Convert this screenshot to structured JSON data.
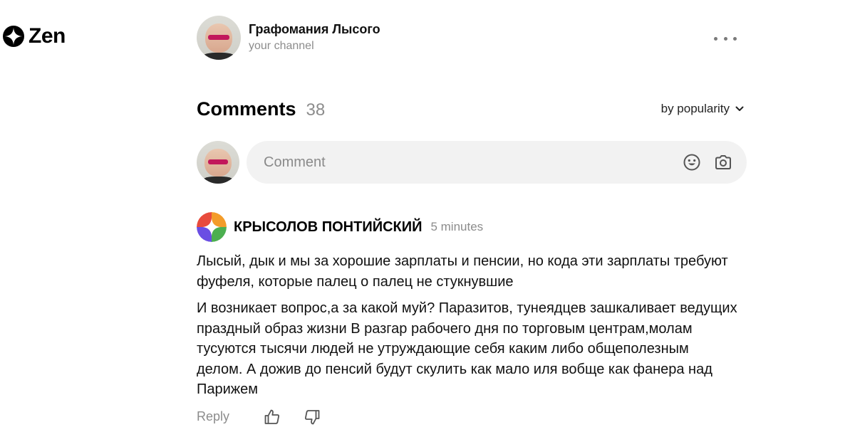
{
  "app": {
    "logo_text": "Zen"
  },
  "channel": {
    "name": "Графомания Лысого",
    "subtitle": "your channel"
  },
  "comments_section": {
    "title": "Comments",
    "count": "38",
    "sort_label": "by popularity",
    "input_placeholder": "Comment"
  },
  "comments": [
    {
      "author": "КРЫСОЛОВ ПОНТИЙСКИЙ",
      "time": "5 minutes",
      "paragraphs": [
        "Лысый, дык и мы за хорошие зарплаты и пенсии, но кода эти зарплаты требуют фуфеля, которые палец о палец не стукнувшие",
        "И возникает вопрос,а за какой муй? Паразитов, тунеядцев зашкаливает ведущих праздный образ жизни В разгар рабочего дня по торговым центрам,молам тусуются тысячи людей не утруждающие себя каким либо общеполезным делом. А дожив до пенсий будут скулить как мало иля вобще как фанера над Парижем"
      ],
      "reply_label": "Reply"
    }
  ],
  "icons": {
    "logo": "zen-star-icon",
    "more": "more-dots-icon",
    "sort": "chevron-down-icon",
    "emoji": "emoji-icon",
    "camera": "camera-icon",
    "like": "thumbs-up-icon",
    "dislike": "thumbs-down-icon"
  },
  "colors": {
    "background": "#ffffff",
    "input_background": "#f2f2f2",
    "secondary_text": "#8c8c8c",
    "avatar_segments": [
      "#f39c2a",
      "#4caf50",
      "#6a4ee3",
      "#e84b3c"
    ]
  }
}
